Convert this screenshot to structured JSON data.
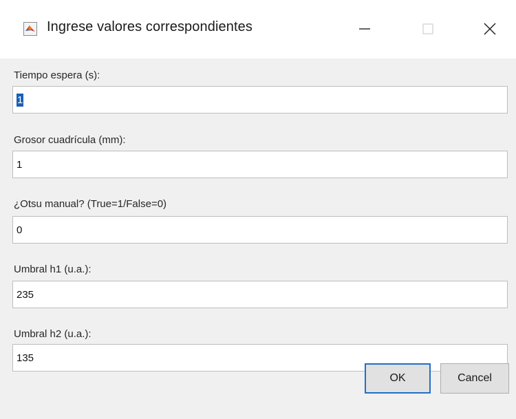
{
  "window": {
    "title": "Ingrese valores correspondientes",
    "app_icon": "matlab-logo-icon",
    "controls": {
      "minimize_icon": "minimize-icon",
      "maximize_icon": "maximize-icon",
      "close_icon": "close-icon"
    }
  },
  "fields": [
    {
      "label": "Tiempo espera (s):",
      "value": "1",
      "selected": true
    },
    {
      "label": "Grosor cuadrícula (mm):",
      "value": "1",
      "selected": false
    },
    {
      "label": "¿Otsu manual? (True=1/False=0)",
      "value": "0",
      "selected": false
    },
    {
      "label": "Umbral h1 (u.a.):",
      "value": "235",
      "selected": false
    },
    {
      "label": "Umbral h2 (u.a.):",
      "value": "135",
      "selected": false
    }
  ],
  "buttons": {
    "ok_label": "OK",
    "cancel_label": "Cancel"
  },
  "colors": {
    "selection": "#1a5fb4",
    "default_button_border": "#1f6fc9",
    "dialog_background": "#f0f0f0"
  }
}
